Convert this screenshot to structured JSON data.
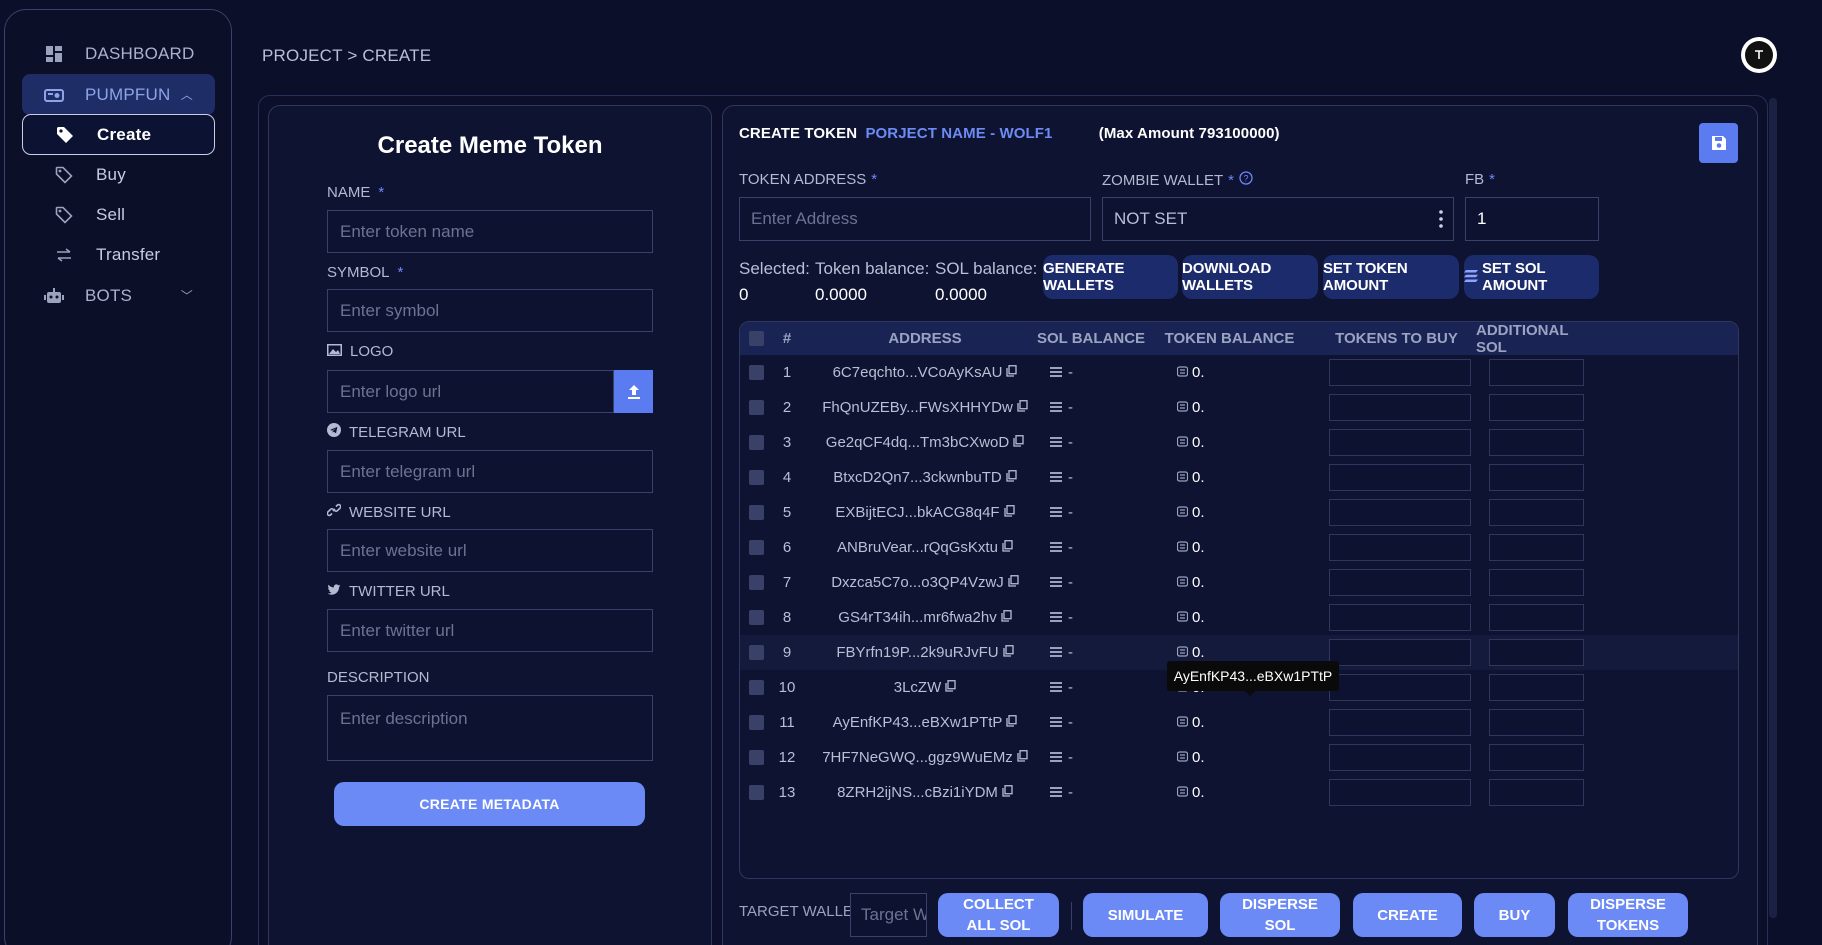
{
  "sidebar": {
    "items": [
      {
        "label": "DASHBOARD",
        "icon": "grid-icon"
      },
      {
        "label": "PUMPFUN",
        "icon": "pump-icon"
      },
      {
        "label": "Create",
        "icon": "tag-icon"
      },
      {
        "label": "Buy",
        "icon": "tag-outline-icon"
      },
      {
        "label": "Sell",
        "icon": "tag-outline-icon"
      },
      {
        "label": "Transfer",
        "icon": "transfer-icon"
      },
      {
        "label": "BOTS",
        "icon": "robot-icon"
      }
    ]
  },
  "header": {
    "breadcrumb": "PROJECT > CREATE"
  },
  "meta_form": {
    "title": "Create Meme Token",
    "name_label": "NAME",
    "name_placeholder": "Enter token name",
    "symbol_label": "SYMBOL",
    "symbol_placeholder": "Enter symbol",
    "logo_label": "LOGO",
    "logo_placeholder": "Enter logo url",
    "telegram_label": "TELEGRAM URL",
    "telegram_placeholder": "Enter telegram url",
    "website_label": "WEBSITE URL",
    "website_placeholder": "Enter website url",
    "twitter_label": "TWITTER URL",
    "twitter_placeholder": "Enter twitter url",
    "description_label": "DESCRIPTION",
    "description_placeholder": "Enter description",
    "required_mark": "*",
    "submit": "CREATE METADATA"
  },
  "token_panel": {
    "heading": "CREATE TOKEN",
    "project_name": "PORJECT NAME - WOLF1",
    "max_amount": "(Max Amount 793100000)",
    "token_address_label": "TOKEN ADDRESS",
    "token_address_placeholder": "Enter Address",
    "zombie_label": "ZOMBIE WALLET",
    "zombie_value": "NOT SET",
    "fb_label": "FB",
    "fb_value": "1",
    "selected_label": "Selected:",
    "selected_value": "0",
    "token_balance_label": "Token balance:",
    "token_balance_value": "0.0000",
    "sol_balance_label": "SOL balance:",
    "sol_balance_value": "0.0000",
    "buttons": {
      "generate": "GENERATE WALLETS",
      "download": "DOWNLOAD WALLETS",
      "set_token": "SET TOKEN AMOUNT",
      "set_sol": "SET SOL AMOUNT"
    },
    "table": {
      "columns": [
        "#",
        "ADDRESS",
        "SOL BALANCE",
        "TOKEN BALANCE",
        "TOKENS TO BUY",
        "ADDITIONAL SOL"
      ],
      "rows": [
        {
          "n": "1",
          "address": "6C7eqchto...VCoAyKsAU",
          "sol": "-",
          "token": "0."
        },
        {
          "n": "2",
          "address": "FhQnUZEBy...FWsXHHYDw",
          "sol": "-",
          "token": "0."
        },
        {
          "n": "3",
          "address": "Ge2qCF4dq...Tm3bCXwoD",
          "sol": "-",
          "token": "0."
        },
        {
          "n": "4",
          "address": "BtxcD2Qn7...3ckwnbuTD",
          "sol": "-",
          "token": "0."
        },
        {
          "n": "5",
          "address": "EXBijtECJ...bkACG8q4F",
          "sol": "-",
          "token": "0."
        },
        {
          "n": "6",
          "address": "ANBruVear...rQqGsKxtu",
          "sol": "-",
          "token": "0."
        },
        {
          "n": "7",
          "address": "Dxzca5C7o...o3QP4VzwJ",
          "sol": "-",
          "token": "0."
        },
        {
          "n": "8",
          "address": "GS4rT34ih...mr6fwa2hv",
          "sol": "-",
          "token": "0."
        },
        {
          "n": "9",
          "address": "FBYrfn19P...2k9uRJvFU",
          "sol": "-",
          "token": "0."
        },
        {
          "n": "10",
          "address": "3LcZW",
          "sol": "-",
          "token": "0."
        },
        {
          "n": "11",
          "address": "AyEnfKP43...eBXw1PTtP",
          "sol": "-",
          "token": "0."
        },
        {
          "n": "12",
          "address": "7HF7NeGWQ...ggz9WuEMz",
          "sol": "-",
          "token": "0."
        },
        {
          "n": "13",
          "address": "8ZRH2ijNS...cBzi1iYDM",
          "sol": "-",
          "token": "0."
        }
      ],
      "tooltip": "AyEnfKP43...eBXw1PTtP"
    },
    "target_wallet_label": "TARGET WALLET:",
    "target_wallet_placeholder": "Target Wallet",
    "footer_buttons": {
      "collect": "COLLECT\nALL SOL",
      "simulate": "SIMULATE",
      "disperse_sol": "DISPERSE\nSOL",
      "create": "CREATE",
      "buy": "BUY",
      "disperse_tokens": "DISPERSE\nTOKENS"
    }
  },
  "colors": {
    "accent": "#6b8af5",
    "dark_button": "#1c2b6b",
    "background": "#0b0f2a"
  }
}
